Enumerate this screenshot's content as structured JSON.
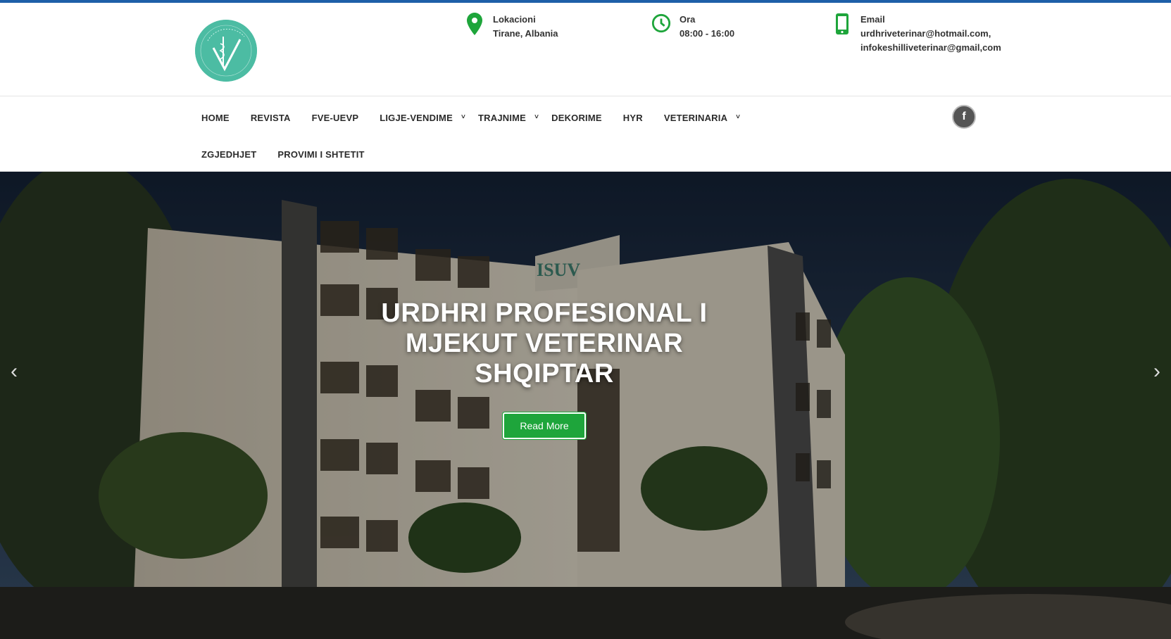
{
  "header": {
    "logo_alt": "Këshilli Veterinar Shqiptar",
    "location": {
      "label": "Lokacioni",
      "value": "Tirane, Albania",
      "icon": "map-pin-icon"
    },
    "hours": {
      "label": "Ora",
      "value": "08:00 - 16:00",
      "icon": "clock-icon"
    },
    "email": {
      "label": "Email",
      "line1": "urdhriveterinar@hotmail.com,",
      "line2": "infokeshilliveterinar@gmail,com",
      "icon": "phone-icon"
    },
    "accent_color": "#1ea53b"
  },
  "nav": {
    "items": [
      {
        "label": "HOME"
      },
      {
        "label": "REVISTA"
      },
      {
        "label": "FVE-UEVP"
      },
      {
        "label": "LIGJE-VENDIME",
        "dropdown": "˅"
      },
      {
        "label": "TRAJNIME",
        "dropdown": "˅"
      },
      {
        "label": "DEKORIME"
      },
      {
        "label": "HYR"
      },
      {
        "label": "VETERINARIA",
        "dropdown": "˅"
      },
      {
        "label": "ZGJEDHJET"
      },
      {
        "label": "PROVIMI I SHTETIT"
      }
    ],
    "social": "f"
  },
  "hero": {
    "title_line1": "URDHRI PROFESIONAL I",
    "title_line2": "MJEKUT VETERINAR",
    "title_line3": "SHQIPTAR",
    "button_label": "Read More",
    "prev_arrow": "‹",
    "next_arrow": "›",
    "building_sign": "ISUV"
  }
}
